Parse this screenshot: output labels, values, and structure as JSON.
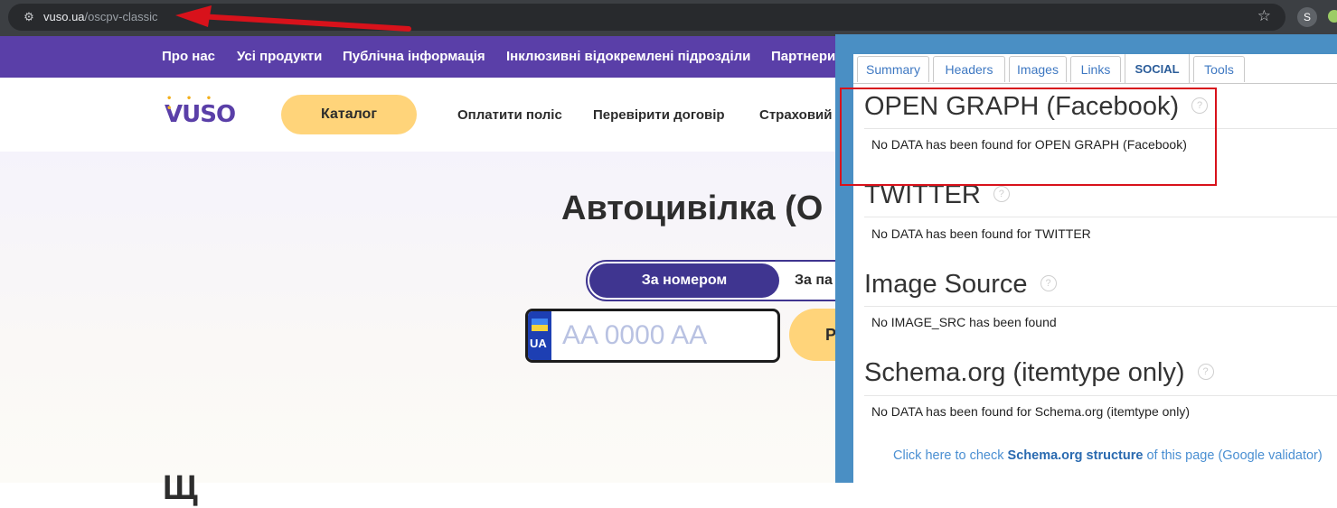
{
  "browser": {
    "url_domain": "vuso.ua",
    "url_path": "/oscpv-classic",
    "site_info_icon": "tune-icon",
    "bookmark_icon": "star-icon",
    "extension_icon_label": "S"
  },
  "site": {
    "top_nav": [
      "Про нас",
      "Усі продукти",
      "Публічна інформація",
      "Інклюзивні відокремлені підрозділи",
      "Партнери"
    ],
    "logo_text": "VUSO",
    "catalog_label": "Каталог",
    "header_links": [
      "Оплатити поліс",
      "Перевірити договір",
      "Страховий"
    ],
    "hero_title": "Автоцивілка (О",
    "toggle_active": "За номером",
    "toggle_inactive": "За па",
    "plate_country": "UA",
    "plate_placeholder": "AA 0000 AA",
    "search_label": "Р",
    "bottom_heading": "Щ"
  },
  "extension": {
    "tabs": [
      "Summary",
      "Headers",
      "Images",
      "Links",
      "SOCIAL",
      "Tools"
    ],
    "active_tab": "SOCIAL",
    "help_glyph": "?",
    "sections": [
      {
        "title": "OPEN GRAPH (Facebook)",
        "message": "No DATA has been found for OPEN GRAPH (Facebook)"
      },
      {
        "title": "TWITTER",
        "message": "No DATA has been found for TWITTER"
      },
      {
        "title": "Image Source",
        "message": "No IMAGE_SRC has been found"
      },
      {
        "title": "Schema.org (itemtype only)",
        "message": "No DATA has been found for Schema.org (itemtype only)"
      }
    ],
    "validator_prefix": "Click here to check ",
    "validator_link": "Schema.org structure",
    "validator_suffix": " of this page (Google validator)"
  },
  "annotation_colors": {
    "arrow": "#d8121b",
    "highlight": "#d8121b"
  }
}
